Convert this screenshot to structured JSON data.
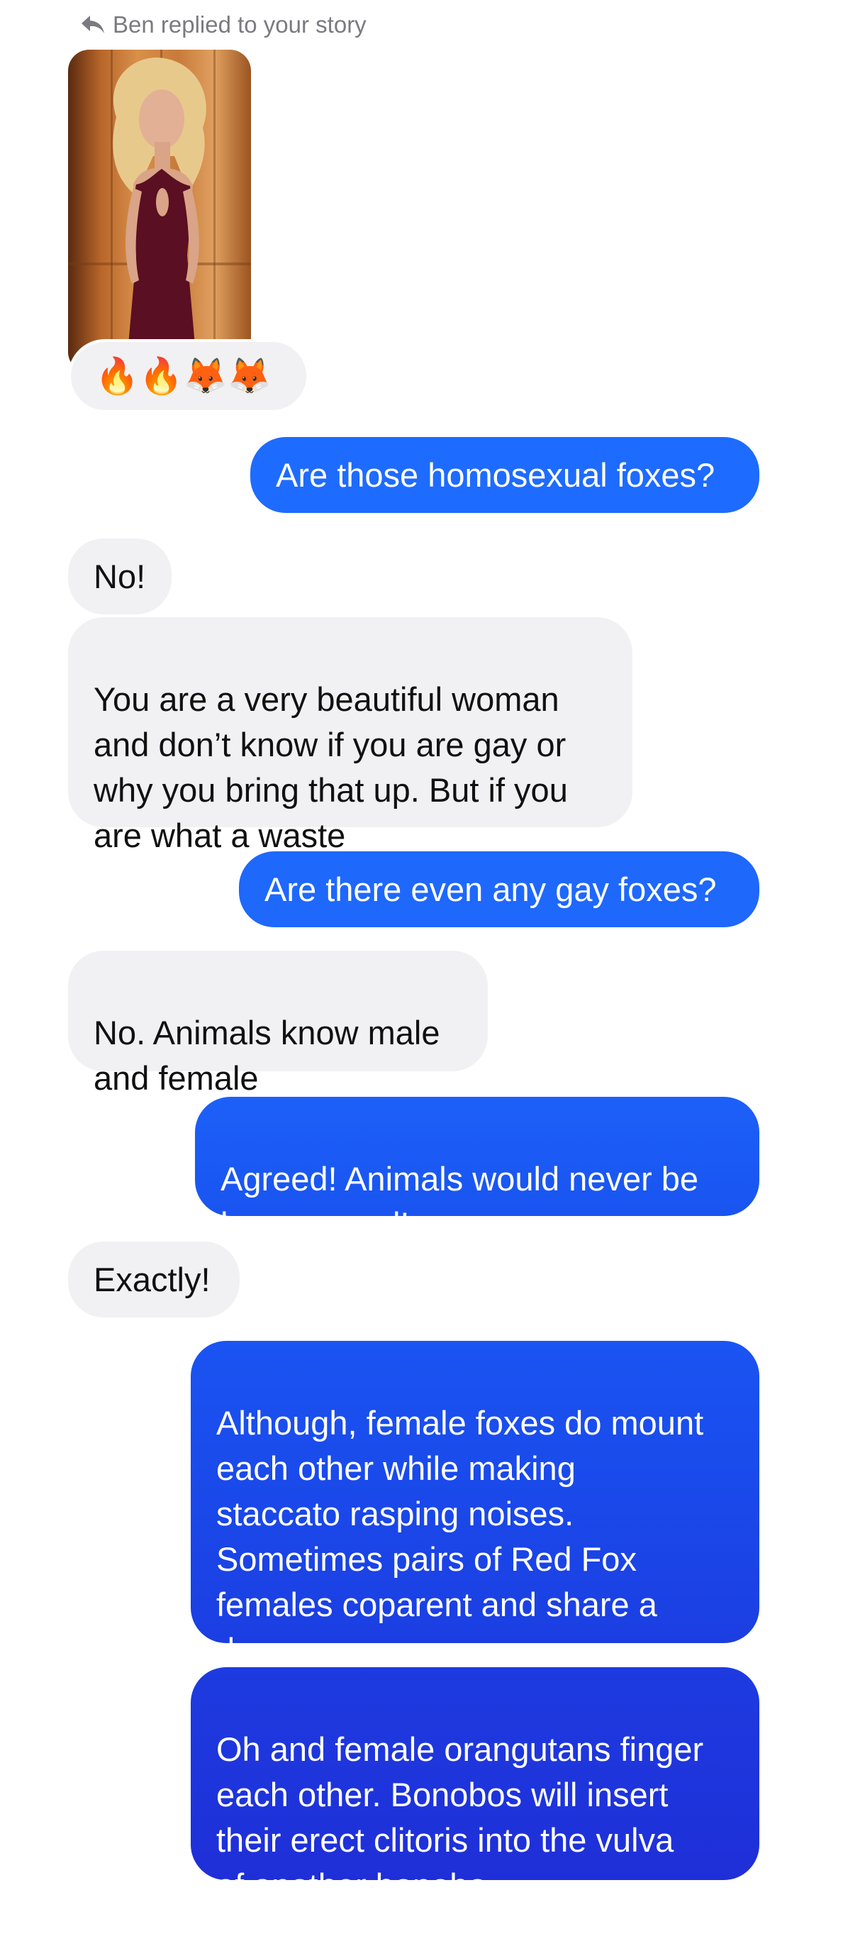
{
  "reply_header": {
    "text": "Ben replied to your story",
    "icon": "reply-arrow-icon",
    "color": "#7a7a80"
  },
  "story": {
    "reaction": "🔥🔥🦊🦊"
  },
  "colors": {
    "incoming_bg": "#f1f1f4",
    "outgoing_top": "#1e6bff",
    "outgoing_bottom": "#1f2fd8",
    "text_dark": "#111111"
  },
  "messages": [
    {
      "from": "me",
      "text": "Are those homosexual foxes?"
    },
    {
      "from": "them",
      "text": "No!"
    },
    {
      "from": "them",
      "text": "You are a very beautiful woman\nand don’t know if you are gay or\nwhy you bring that up. But if you\nare what a waste"
    },
    {
      "from": "me",
      "text": "Are there even any gay foxes?"
    },
    {
      "from": "them",
      "text": "No. Animals know male\nand female"
    },
    {
      "from": "me",
      "text": "Agreed! Animals would never be\nhomosexual!"
    },
    {
      "from": "them",
      "text": "Exactly!"
    },
    {
      "from": "me",
      "text": "Although, female foxes do mount\neach other while making\nstaccato rasping noises.\nSometimes pairs of Red Fox\nfemales coparent and share a\nden."
    },
    {
      "from": "me",
      "text": "Oh and female orangutans finger\neach other. Bonobos will insert\ntheir erect clitoris into the vulva\nof another bonobo."
    }
  ]
}
